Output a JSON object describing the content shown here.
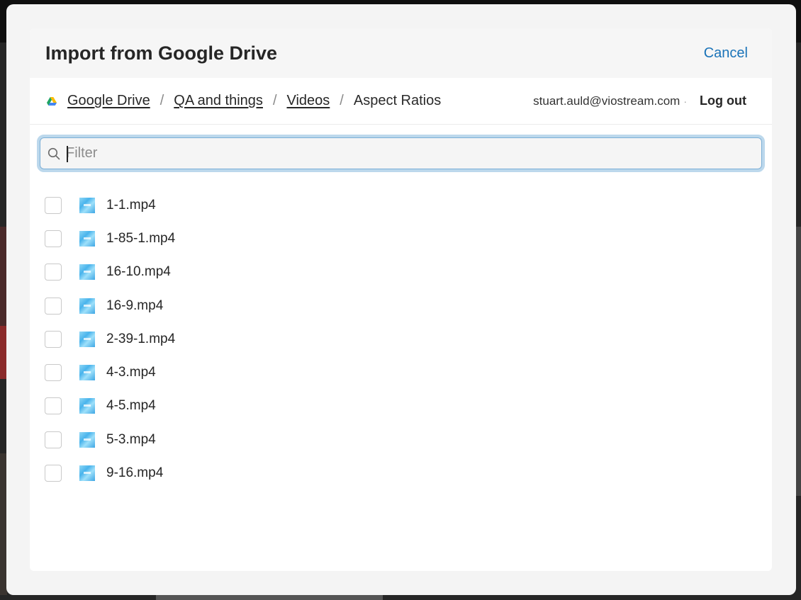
{
  "dialog": {
    "title": "Import from Google Drive",
    "cancel_label": "Cancel"
  },
  "breadcrumb": {
    "root_icon": "google-drive-icon",
    "items": [
      "Google Drive",
      "QA and things",
      "Videos",
      "Aspect Ratios"
    ],
    "separator": "/"
  },
  "account": {
    "email": "stuart.auld@viostream.com",
    "dot": "·",
    "logout_label": "Log out"
  },
  "filter": {
    "placeholder": "Filter",
    "value": "",
    "icon": "search-icon"
  },
  "files": [
    {
      "name": "1-1.mp4",
      "checked": false
    },
    {
      "name": "1-85-1.mp4",
      "checked": false
    },
    {
      "name": "16-10.mp4",
      "checked": false
    },
    {
      "name": "16-9.mp4",
      "checked": false
    },
    {
      "name": "2-39-1.mp4",
      "checked": false
    },
    {
      "name": "4-3.mp4",
      "checked": false
    },
    {
      "name": "4-5.mp4",
      "checked": false
    },
    {
      "name": "5-3.mp4",
      "checked": false
    },
    {
      "name": "9-16.mp4",
      "checked": false
    }
  ],
  "colors": {
    "accent": "#1a73b8",
    "focus_ring": "#bcd8ec"
  }
}
